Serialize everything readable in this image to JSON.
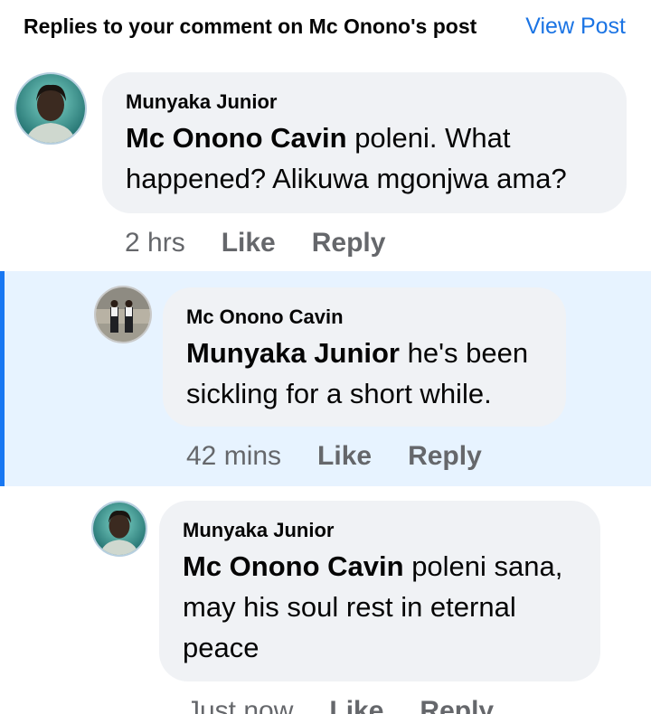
{
  "header": {
    "title": "Replies to your comment on Mc Onono's post",
    "view_post": "View Post"
  },
  "comments": [
    {
      "author": "Munyaka Junior",
      "mention": "Mc Onono Cavin",
      "text_line1": " poleni. What",
      "text_line2": "happened? Alikuwa mgonjwa ama?",
      "time": "2 hrs",
      "like": "Like",
      "reply": "Reply"
    },
    {
      "author": "Mc Onono Cavin",
      "mention": "Munyaka Junior",
      "text_line1": " he's been",
      "text_line2": "sickling for a short while.",
      "time": "42 mins",
      "like": "Like",
      "reply": "Reply"
    },
    {
      "author": "Munyaka Junior",
      "mention": "Mc Onono Cavin",
      "text_line1": " poleni sana,",
      "text_line2": "may his soul rest in eternal",
      "text_line3": "peace",
      "time": "Just now",
      "like": "Like",
      "reply": "Reply"
    }
  ],
  "colors": {
    "link": "#1b74e4",
    "highlight": "#e7f3ff",
    "accent_bar": "#1877f2",
    "bubble": "#f0f2f5",
    "meta": "#65676b"
  },
  "icons": {
    "avatar_1": "profile-photo-munyaka-junior",
    "avatar_2": "profile-photo-mc-onono-cavin",
    "avatar_3": "profile-photo-munyaka-junior"
  }
}
